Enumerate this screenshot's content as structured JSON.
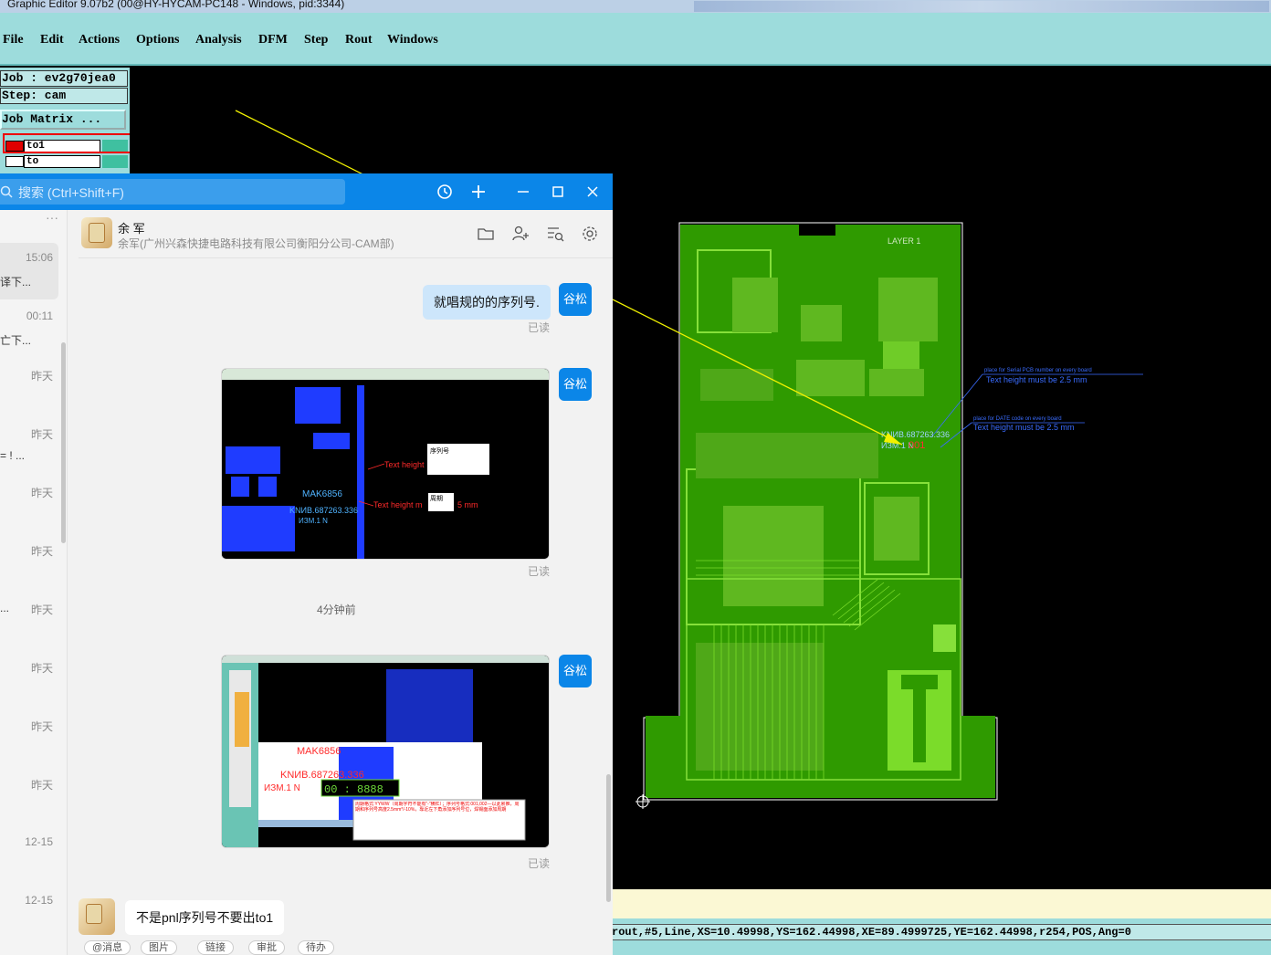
{
  "cam": {
    "title": "Graphic Editor 9.07b2 (00@HY-HYCAM-PC148 - Windows, pid:3344)",
    "menus": [
      "File",
      "Edit",
      "Actions",
      "Options",
      "Analysis",
      "DFM",
      "Step",
      "Rout",
      "Windows"
    ],
    "job": "Job : ev2g70jea0",
    "step": "Step: cam",
    "job_matrix": "Job Matrix ...",
    "layers": [
      {
        "name": "to1",
        "color": "#e00000",
        "selected": true
      },
      {
        "name": "to",
        "color": "#ffffff",
        "selected": false
      }
    ],
    "status_line": "rout,#5,Line,XS=10.49998,YS=162.44998,XE=89.4999725,YE=162.44998,r254,POS,Ang=0"
  },
  "pcb": {
    "board_fill": "#2f9a00",
    "trace_color": "#7bdc2a",
    "layer_label": "LAYER 1",
    "note1_title": "place for Serial  PCB number on every board",
    "note1_text": "Text height must be 2.5 mm",
    "note2_title": "place for DATE code on every board",
    "note2_text": "Text height must be 2.5 mm",
    "serial_text": "KNИВ.687263.336",
    "serial_text2": "ИЗМ.1 N",
    "serial_red": "001"
  },
  "chat": {
    "search_placeholder": "搜索 (Ctrl+Shift+F)",
    "conversations": [
      {
        "time": "15:06",
        "snippet": "译下..."
      },
      {
        "time": "00:11",
        "snippet": "亡下..."
      },
      {
        "time": "昨天",
        "snippet": ""
      },
      {
        "time": "昨天",
        "snippet": "= ! ..."
      },
      {
        "time": "昨天",
        "snippet": ""
      },
      {
        "time": "昨天",
        "snippet": ""
      },
      {
        "time": "昨天",
        "snippet": "..."
      },
      {
        "time": "昨天",
        "snippet": ""
      },
      {
        "time": "昨天",
        "snippet": ""
      },
      {
        "time": "昨天",
        "snippet": ""
      },
      {
        "time": "12-15",
        "snippet": ""
      },
      {
        "time": "12-15",
        "snippet": ""
      }
    ],
    "contact_name": "余 军",
    "contact_org": "余军(广州兴森快捷电路科技有限公司衡阳分公司-CAM部)",
    "my_name": "谷松",
    "msg1": "就唱规的的序列号.",
    "read": "已读",
    "time_sep": "4分钟前",
    "img1": {
      "label1": "Text height",
      "label2": "Text height m",
      "mm": "5 mm",
      "box1": "序列号",
      "box2": "周期",
      "part": "MAK6856",
      "serial": "KNИВ.687263.336",
      "rev": "ИЗМ.1 N"
    },
    "img2": {
      "part": "MAK6856",
      "serial": "KNИВ.687263.336",
      "rev": "ИЗМ.1 N",
      "digits": "00 : 8888",
      "note": "周期格式:YYWW（周期字符不能有“-”横杠）；序列号格式:001,002—以此累推，周期和序列号高度2.5mm*/-10%，靠近左下角添加序列号位，焊锡面添加周期"
    },
    "incoming": "不是pnl序列号不要出to1",
    "tools": [
      "@消息",
      "图片",
      "链接",
      "审批",
      "待办"
    ]
  }
}
